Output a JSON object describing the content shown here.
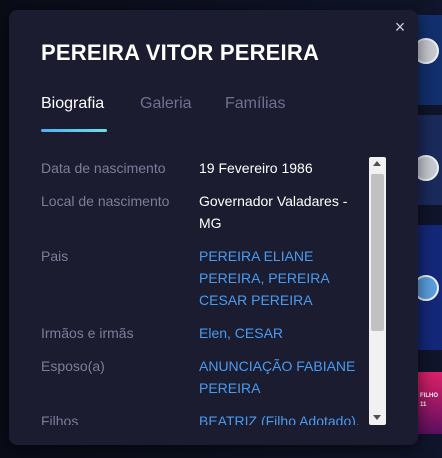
{
  "modal": {
    "title": "PEREIRA VITOR PEREIRA",
    "close_icon": "×",
    "tabs": [
      {
        "label": "Biografia",
        "active": true
      },
      {
        "label": "Galeria",
        "active": false
      },
      {
        "label": "Famílias",
        "active": false
      }
    ],
    "bio": {
      "birth_date_label": "Data de nascimento",
      "birth_date": "19 Fevereiro 1986",
      "birth_place_label": "Local de nascimento",
      "birth_place": "Governador Valadares - MG",
      "parents_label": "Pais",
      "parents": "PEREIRA ELIANE PEREIRA, PEREIRA CESAR PEREIRA",
      "siblings_label": "Irmãos e irmãs",
      "siblings": "Elen,  CESAR",
      "spouse_label": "Esposo(a)",
      "spouse": "ANUNCIAÇÃO FABIANE PEREIRA",
      "children_label": "Filhos",
      "children": "BEATRIZ (Filho Adotado), ISABELLA,  SAMUEL"
    }
  },
  "background": {
    "card_text": "FILHO 11"
  },
  "colors": {
    "modal_bg": "#1b1c2f",
    "label": "#7b7e9a",
    "link": "#4a9bf0",
    "tab_active": "#ffffff",
    "tab_inactive": "#6e7191",
    "underline": "#5cc8ee"
  }
}
